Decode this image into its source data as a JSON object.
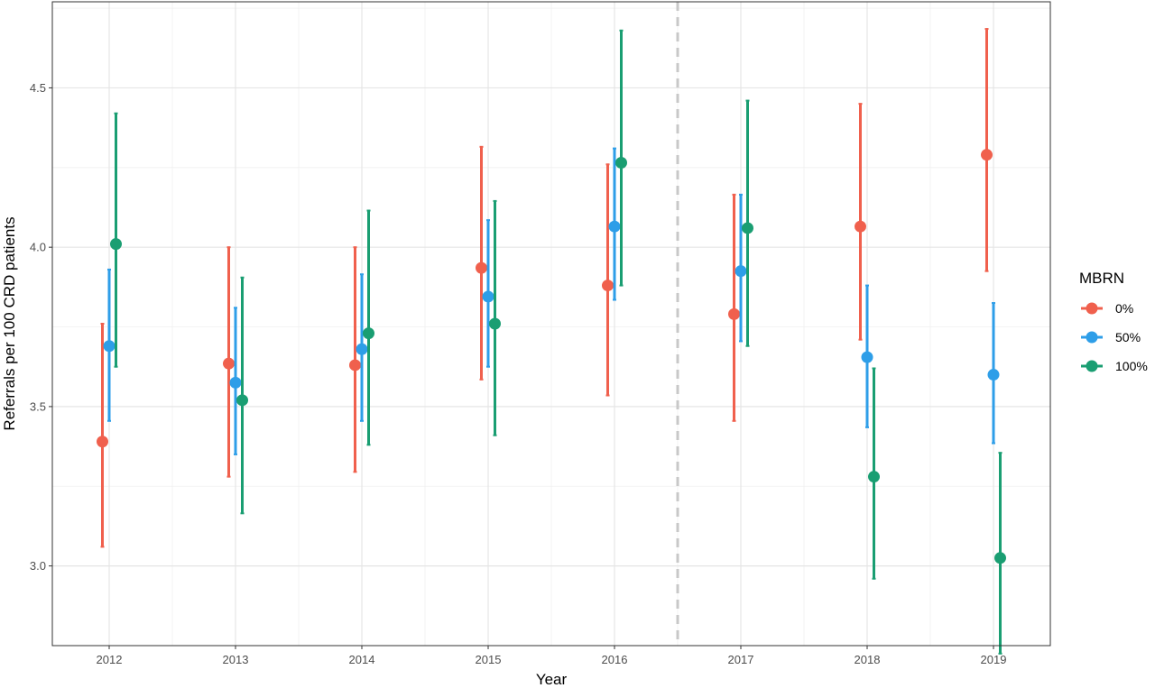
{
  "chart_data": {
    "type": "scatter",
    "title": "",
    "xlabel": "Year",
    "ylabel": "Referrals per 100 CRD patients",
    "categories": [
      "2012",
      "2013",
      "2014",
      "2015",
      "2016",
      "2017",
      "2018",
      "2019"
    ],
    "ylim": [
      2.75,
      4.77
    ],
    "yticks": [
      3.0,
      3.5,
      4.0,
      4.5
    ],
    "ytick_labels": [
      "3.0",
      "3.5",
      "4.0",
      "4.5"
    ],
    "grid": true,
    "vline_between": [
      "2016",
      "2017"
    ],
    "legend": {
      "title": "MBRN",
      "position": "right"
    },
    "series": [
      {
        "name": "0%",
        "color": "#F0604D",
        "values": [
          3.39,
          3.635,
          3.63,
          3.935,
          3.88,
          3.79,
          4.065,
          4.29
        ],
        "lower": [
          3.06,
          3.28,
          3.295,
          3.585,
          3.535,
          3.455,
          3.71,
          3.925
        ],
        "upper": [
          3.76,
          4.0,
          4.0,
          4.315,
          4.26,
          4.165,
          4.45,
          4.685
        ]
      },
      {
        "name": "50%",
        "color": "#2E9EE8",
        "values": [
          3.69,
          3.575,
          3.68,
          3.845,
          4.065,
          3.925,
          3.655,
          3.6
        ],
        "lower": [
          3.455,
          3.35,
          3.455,
          3.625,
          3.835,
          3.705,
          3.435,
          3.385
        ],
        "upper": [
          3.93,
          3.81,
          3.915,
          4.085,
          4.31,
          4.165,
          3.88,
          3.825
        ]
      },
      {
        "name": "100%",
        "color": "#1A9E72",
        "values": [
          4.01,
          3.52,
          3.73,
          3.76,
          4.265,
          4.06,
          3.28,
          3.025
        ],
        "lower": [
          3.625,
          3.165,
          3.38,
          3.41,
          3.88,
          3.69,
          2.96,
          2.725
        ],
        "upper": [
          4.42,
          3.905,
          4.115,
          4.145,
          4.68,
          4.46,
          3.62,
          3.355
        ]
      }
    ]
  }
}
